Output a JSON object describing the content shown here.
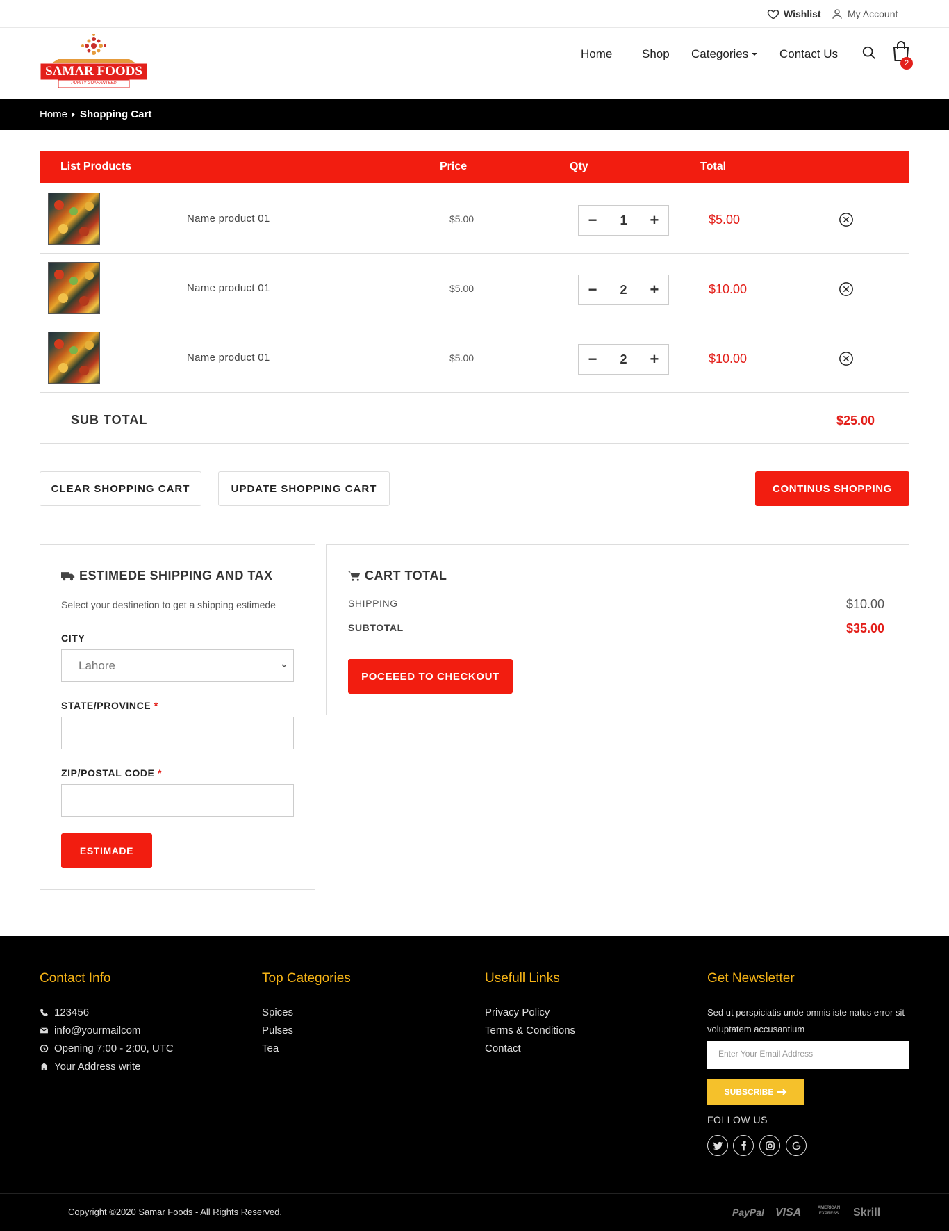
{
  "topbar": {
    "wishlist": "Wishlist",
    "account": "My Account"
  },
  "logo": {
    "brand": "SAMAR FOODS",
    "tagline": "PURITY GUARANTEED"
  },
  "nav": {
    "home": "Home",
    "shop": "Shop",
    "categories": "Categories",
    "contact": "Contact Us",
    "cart_count": "2"
  },
  "breadcrumb": {
    "home": "Home",
    "current": "Shopping Cart"
  },
  "cart": {
    "headers": {
      "products": "List Products",
      "price": "Price",
      "qty": "Qty",
      "total": "Total"
    },
    "items": [
      {
        "name": "Name product 01",
        "price": "$5.00",
        "qty": "1",
        "total": "$5.00"
      },
      {
        "name": "Name product 01",
        "price": "$5.00",
        "qty": "2",
        "total": "$10.00"
      },
      {
        "name": "Name product 01",
        "price": "$5.00",
        "qty": "2",
        "total": "$10.00"
      }
    ],
    "subtotal_label": "SUB TOTAL",
    "subtotal_value": "$25.00"
  },
  "actions": {
    "clear": "CLEAR SHOPPING CART",
    "update": "UPDATE SHOPPING CART",
    "continue": "CONTINUS SHOPPING"
  },
  "shipping": {
    "title": "ESTIMEDE SHIPPING AND TAX",
    "desc": "Select your destinetion to get a shipping estimede",
    "city_label": "CITY",
    "city_value": "Lahore",
    "state_label": "STATE/PROVINCE",
    "zip_label": "ZIP/POSTAL CODE",
    "required_mark": "*",
    "button": "ESTIMADE"
  },
  "cart_total": {
    "title": "CART TOTAL",
    "shipping_label": "SHIPPING",
    "shipping_value": "$10.00",
    "subtotal_label": "SUBTOTAL",
    "subtotal_value": "$35.00",
    "checkout": "POCEEED TO CHECKOUT"
  },
  "footer": {
    "contact": {
      "title": "Contact Info",
      "phone": "123456",
      "email": "info@yourmailcom",
      "hours": "Opening 7:00 - 2:00, UTC",
      "address": "Your Address write"
    },
    "categories": {
      "title": "Top Categories",
      "items": [
        "Spices",
        "Pulses",
        "Tea"
      ]
    },
    "links": {
      "title": "Usefull Links",
      "items": [
        "Privacy Policy",
        "Terms & Conditions",
        "Contact"
      ]
    },
    "newsletter": {
      "title": "Get Newsletter",
      "text": "Sed ut perspiciatis unde omnis iste natus error sit voluptatem accusantium",
      "placeholder": "Enter Your Email Address",
      "button": "SUBSCRIBE",
      "follow": "FOLLOW US"
    },
    "copyright": "Copyright ©2020 Samar Foods - All Rights Reserved.",
    "payments": [
      "PayPal",
      "VISA",
      "AMERICAN EXPRESS",
      "Skrill"
    ]
  },
  "colors": {
    "accent": "#f21d10",
    "price_red": "#e3201b",
    "footer_gold": "#f5b316",
    "subscribe_yellow": "#f5c12b"
  }
}
